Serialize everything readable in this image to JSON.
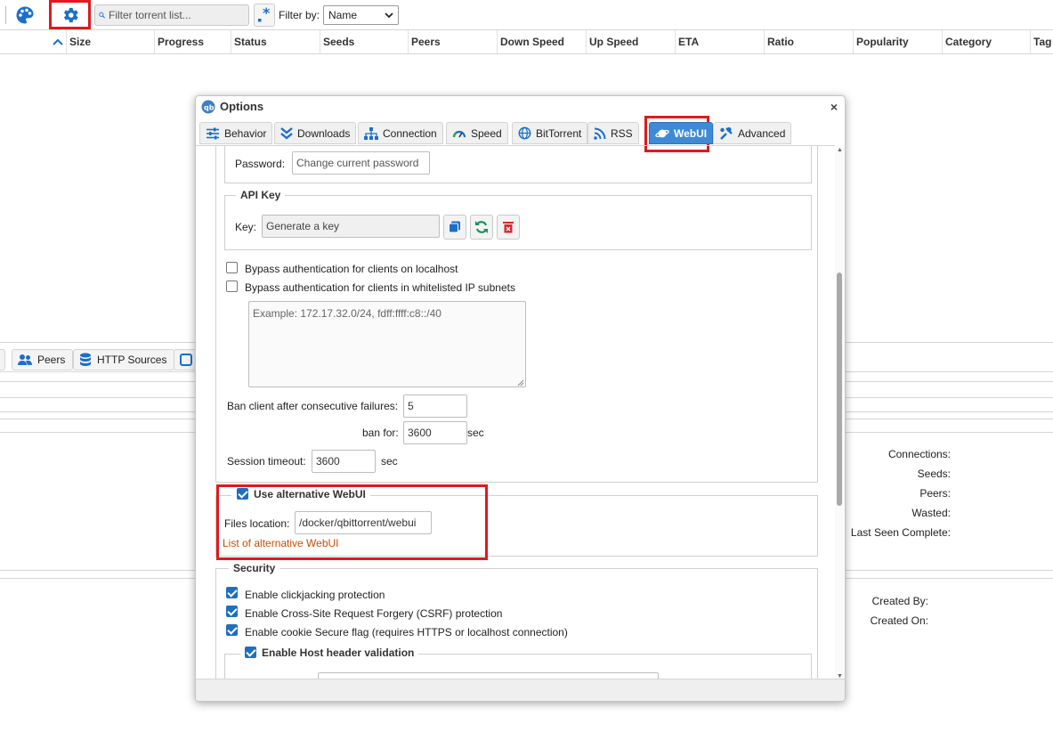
{
  "toolbar": {
    "search_placeholder": "Filter torrent list...",
    "filter_label": "Filter by:",
    "filter_value": "Name"
  },
  "columns": [
    "Size",
    "Progress",
    "Status",
    "Seeds",
    "Peers",
    "Down Speed",
    "Up Speed",
    "ETA",
    "Ratio",
    "Popularity",
    "Category",
    "Tag"
  ],
  "bottom_tabs": [
    "Peers",
    "HTTP Sources"
  ],
  "properties": {
    "transfer": [
      "Connections:",
      "Seeds:",
      "Peers:",
      "Wasted:",
      "Last Seen Complete:"
    ],
    "info": [
      "Created By:",
      "Created On:"
    ]
  },
  "dialog": {
    "title": "Options",
    "close": "×",
    "tabs": [
      "Behavior",
      "Downloads",
      "Connection",
      "Speed",
      "BitTorrent",
      "RSS",
      "WebUI",
      "Advanced"
    ],
    "active_tab": "WebUI",
    "password_label": "Password:",
    "password_placeholder": "Change current password",
    "api_key": {
      "legend": "API Key",
      "key_label": "Key:",
      "key_placeholder": "Generate a key"
    },
    "bypass_localhost": "Bypass authentication for clients on localhost",
    "bypass_whitelist": "Bypass authentication for clients in whitelisted IP subnets",
    "whitelist_placeholder": "Example: 172.17.32.0/24, fdff:ffff:c8::/40",
    "ban_label": "Ban client after consecutive failures:",
    "ban_value": "5",
    "ban_for_label": "ban for:",
    "ban_for_value": "3600",
    "sec1": "sec",
    "session_label": "Session timeout:",
    "session_value": "3600",
    "sec2": "sec",
    "alt_webui": {
      "legend": "Use alternative WebUI",
      "files_label": "Files location:",
      "files_value": "/docker/qbittorrent/webui",
      "link": "List of alternative WebUI"
    },
    "security": {
      "legend": "Security",
      "clickjacking": "Enable clickjacking protection",
      "csrf": "Enable Cross-Site Request Forgery (CSRF) protection",
      "cookie": "Enable cookie Secure flag (requires HTTPS or localhost connection)",
      "host_header": "Enable Host header validation"
    }
  }
}
